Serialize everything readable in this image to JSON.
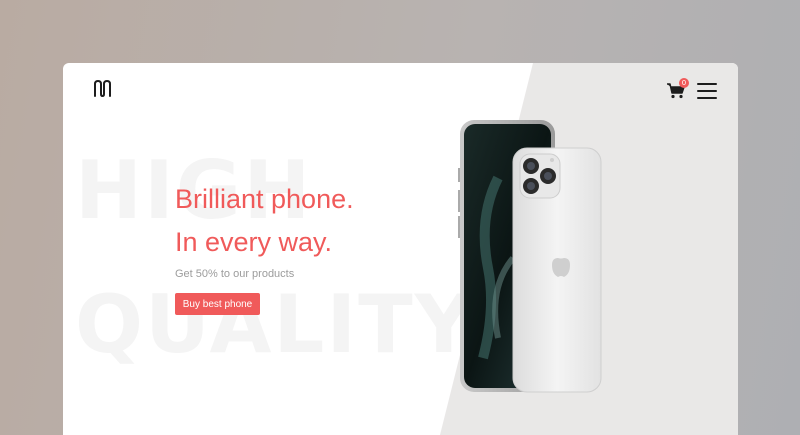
{
  "header": {
    "logo_icon": "m-logo-icon",
    "cart_icon": "shopping-cart-icon",
    "cart_count": "0",
    "menu_icon": "hamburger-menu-icon"
  },
  "background_text": {
    "top": "HIGH",
    "bottom": "QUALITY"
  },
  "hero": {
    "headline_line1": "Brilliant phone.",
    "headline_line2": "In every way.",
    "subtext": "Get 50% to our products",
    "cta_label": "Buy best phone"
  },
  "product": {
    "image_icon": "iphone-product-image"
  },
  "colors": {
    "accent": "#f05a5a",
    "panel_gray": "#e9e8e7",
    "text_gray": "#9c9c9c"
  }
}
